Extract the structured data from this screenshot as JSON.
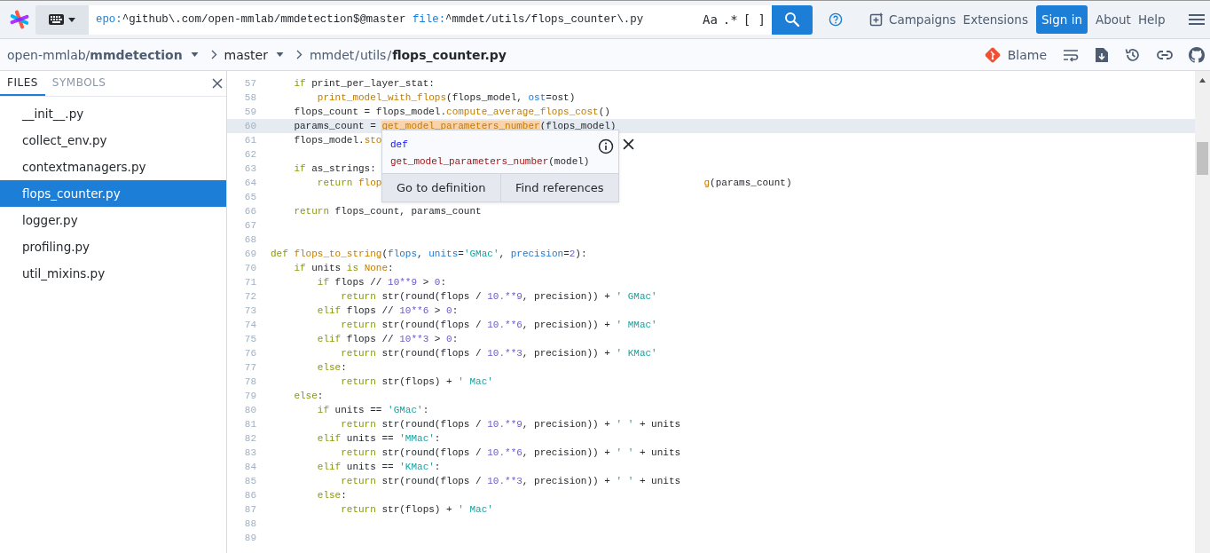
{
  "search": {
    "query": [
      {
        "kind": "filter",
        "text": "epo:"
      },
      {
        "kind": "value",
        "text": "^github\\.com/open-mmlab/mmdetection$@master "
      },
      {
        "kind": "filter",
        "text": "file:"
      },
      {
        "kind": "value",
        "text": "^mmdet/utils/flops_counter\\.py"
      }
    ],
    "toggles": [
      {
        "label": "Aa",
        "on": false
      },
      {
        "label": ".*",
        "on": false
      },
      {
        "label": "[ ]",
        "on": false
      }
    ]
  },
  "nav": [
    {
      "kind": "link",
      "label": "Campaigns",
      "icon": true
    },
    {
      "kind": "link",
      "label": "Extensions",
      "icon": false
    },
    {
      "kind": "primary",
      "label": "Sign in",
      "icon": false
    },
    {
      "kind": "link",
      "label": "About",
      "icon": false
    },
    {
      "kind": "link",
      "label": "Help",
      "icon": false
    }
  ],
  "breadcrumb": {
    "repo": "open-mmlab/**mmdetection**",
    "revision": "master",
    "path": [
      {
        "kind": "segment",
        "text": "mmdet"
      },
      {
        "kind": "separator",
        "text": "/"
      },
      {
        "kind": "segment",
        "text": "utils"
      },
      {
        "kind": "separator",
        "text": "/"
      }
    ],
    "file": "flops_counter.py"
  },
  "actions": {
    "blame": "Blame"
  },
  "sidebar": {
    "tabs": [
      {
        "label": "FILES",
        "selected": true
      },
      {
        "label": "SYMBOLS",
        "selected": false
      }
    ],
    "items": [
      {
        "label": "__init__.py",
        "selected": false
      },
      {
        "label": "collect_env.py",
        "selected": false
      },
      {
        "label": "contextmanagers.py",
        "selected": false
      },
      {
        "label": "flops_counter.py",
        "selected": true
      },
      {
        "label": "logger.py",
        "selected": false
      },
      {
        "label": "profiling.py",
        "selected": false
      },
      {
        "label": "util_mixins.py",
        "selected": false
      }
    ]
  },
  "code": [
    {
      "n": "57",
      "highlighted": false,
      "tokens": [
        {
          "kind": "kw",
          "t": "    if"
        },
        {
          "kind": "p",
          "t": " print_per_layer_stat:"
        }
      ]
    },
    {
      "n": "58",
      "highlighted": false,
      "tokens": [
        {
          "kind": "fn",
          "t": "        print_model_with_flops"
        },
        {
          "kind": "p",
          "t": "(flops_model, "
        },
        {
          "kind": "param",
          "t": "ost"
        },
        {
          "kind": "p",
          "t": "=ost)"
        }
      ]
    },
    {
      "n": "59",
      "highlighted": false,
      "tokens": [
        {
          "kind": "p",
          "t": "    flops_count = flops_model."
        },
        {
          "kind": "fn",
          "t": "compute_average_flops_cost"
        },
        {
          "kind": "p",
          "t": "()"
        }
      ]
    },
    {
      "n": "60",
      "highlighted": true,
      "tokens": [
        {
          "kind": "p",
          "t": "    params_count = "
        },
        {
          "kind": "match",
          "t": "get_model_parameters_number"
        },
        {
          "kind": "p",
          "t": "(flops_model)"
        }
      ]
    },
    {
      "n": "61",
      "highlighted": false,
      "tokens": [
        {
          "kind": "p",
          "t": "    flops_model."
        },
        {
          "kind": "fn",
          "t": "sto"
        }
      ]
    },
    {
      "n": "62",
      "highlighted": false
    },
    {
      "n": "63",
      "highlighted": false,
      "tokens": [
        {
          "kind": "kw",
          "t": "    if"
        },
        {
          "kind": "p",
          "t": " as_strings:"
        }
      ]
    },
    {
      "n": "64",
      "highlighted": false,
      "tokens": [
        {
          "kind": "kw",
          "t": "        return"
        },
        {
          "kind": "fn",
          "t": " flop"
        }
      ],
      "tail": [
        {
          "kind": "fn",
          "t": "g"
        },
        {
          "kind": "p",
          "t": "(params_count)"
        }
      ]
    },
    {
      "n": "65",
      "highlighted": false
    },
    {
      "n": "66",
      "highlighted": false,
      "tokens": [
        {
          "kind": "kw",
          "t": "    return"
        },
        {
          "kind": "p",
          "t": " flops_count, params_count"
        }
      ]
    },
    {
      "n": "67",
      "highlighted": false
    },
    {
      "n": "68",
      "highlighted": false
    },
    {
      "n": "69",
      "highlighted": false,
      "tokens": [
        {
          "kind": "kw",
          "t": "def"
        },
        {
          "kind": "fn",
          "t": " flops_to_string"
        },
        {
          "kind": "p",
          "t": "("
        },
        {
          "kind": "param",
          "t": "flops"
        },
        {
          "kind": "p",
          "t": ", "
        },
        {
          "kind": "param",
          "t": "units"
        },
        {
          "kind": "p",
          "t": "="
        },
        {
          "kind": "str",
          "t": "'GMac'"
        },
        {
          "kind": "p",
          "t": ", "
        },
        {
          "kind": "param",
          "t": "precision"
        },
        {
          "kind": "p",
          "t": "="
        },
        {
          "kind": "num",
          "t": "2"
        },
        {
          "kind": "p",
          "t": "):"
        }
      ]
    },
    {
      "n": "70",
      "highlighted": false,
      "tokens": [
        {
          "kind": "kw",
          "t": "    if"
        },
        {
          "kind": "p",
          "t": " units "
        },
        {
          "kind": "kw",
          "t": "is"
        },
        {
          "kind": "fn",
          "t": " None"
        },
        {
          "kind": "p",
          "t": ":"
        }
      ]
    },
    {
      "n": "71",
      "highlighted": false,
      "tokens": [
        {
          "kind": "kw",
          "t": "        if"
        },
        {
          "kind": "p",
          "t": " flops // "
        },
        {
          "kind": "num",
          "t": "10**9"
        },
        {
          "kind": "p",
          "t": " > "
        },
        {
          "kind": "num",
          "t": "0"
        },
        {
          "kind": "p",
          "t": ":"
        }
      ]
    },
    {
      "n": "72",
      "highlighted": false,
      "tokens": [
        {
          "kind": "kw",
          "t": "            return"
        },
        {
          "kind": "p",
          "t": " str(round(flops / "
        },
        {
          "kind": "num",
          "t": "10.**9"
        },
        {
          "kind": "p",
          "t": ", precision)) + "
        },
        {
          "kind": "str",
          "t": "' GMac'"
        }
      ]
    },
    {
      "n": "73",
      "highlighted": false,
      "tokens": [
        {
          "kind": "kw",
          "t": "        elif"
        },
        {
          "kind": "p",
          "t": " flops // "
        },
        {
          "kind": "num",
          "t": "10**6"
        },
        {
          "kind": "p",
          "t": " > "
        },
        {
          "kind": "num",
          "t": "0"
        },
        {
          "kind": "p",
          "t": ":"
        }
      ]
    },
    {
      "n": "74",
      "highlighted": false,
      "tokens": [
        {
          "kind": "kw",
          "t": "            return"
        },
        {
          "kind": "p",
          "t": " str(round(flops / "
        },
        {
          "kind": "num",
          "t": "10.**6"
        },
        {
          "kind": "p",
          "t": ", precision)) + "
        },
        {
          "kind": "str",
          "t": "' MMac'"
        }
      ]
    },
    {
      "n": "75",
      "highlighted": false,
      "tokens": [
        {
          "kind": "kw",
          "t": "        elif"
        },
        {
          "kind": "p",
          "t": " flops // "
        },
        {
          "kind": "num",
          "t": "10**3"
        },
        {
          "kind": "p",
          "t": " > "
        },
        {
          "kind": "num",
          "t": "0"
        },
        {
          "kind": "p",
          "t": ":"
        }
      ]
    },
    {
      "n": "76",
      "highlighted": false,
      "tokens": [
        {
          "kind": "kw",
          "t": "            return"
        },
        {
          "kind": "p",
          "t": " str(round(flops / "
        },
        {
          "kind": "num",
          "t": "10.**3"
        },
        {
          "kind": "p",
          "t": ", precision)) + "
        },
        {
          "kind": "str",
          "t": "' KMac'"
        }
      ]
    },
    {
      "n": "77",
      "highlighted": false,
      "tokens": [
        {
          "kind": "kw",
          "t": "        else"
        },
        {
          "kind": "p",
          "t": ":"
        }
      ]
    },
    {
      "n": "78",
      "highlighted": false,
      "tokens": [
        {
          "kind": "kw",
          "t": "            return"
        },
        {
          "kind": "p",
          "t": " str(flops) + "
        },
        {
          "kind": "str",
          "t": "' Mac'"
        }
      ]
    },
    {
      "n": "79",
      "highlighted": false,
      "tokens": [
        {
          "kind": "kw",
          "t": "    else"
        },
        {
          "kind": "p",
          "t": ":"
        }
      ]
    },
    {
      "n": "80",
      "highlighted": false,
      "tokens": [
        {
          "kind": "kw",
          "t": "        if"
        },
        {
          "kind": "p",
          "t": " units == "
        },
        {
          "kind": "str",
          "t": "'GMac'"
        },
        {
          "kind": "p",
          "t": ":"
        }
      ]
    },
    {
      "n": "81",
      "highlighted": false,
      "tokens": [
        {
          "kind": "kw",
          "t": "            return"
        },
        {
          "kind": "p",
          "t": " str(round(flops / "
        },
        {
          "kind": "num",
          "t": "10.**9"
        },
        {
          "kind": "p",
          "t": ", precision)) + "
        },
        {
          "kind": "str",
          "t": "' '"
        },
        {
          "kind": "p",
          "t": " + units"
        }
      ]
    },
    {
      "n": "82",
      "highlighted": false,
      "tokens": [
        {
          "kind": "kw",
          "t": "        elif"
        },
        {
          "kind": "p",
          "t": " units == "
        },
        {
          "kind": "str",
          "t": "'MMac'"
        },
        {
          "kind": "p",
          "t": ":"
        }
      ]
    },
    {
      "n": "83",
      "highlighted": false,
      "tokens": [
        {
          "kind": "kw",
          "t": "            return"
        },
        {
          "kind": "p",
          "t": " str(round(flops / "
        },
        {
          "kind": "num",
          "t": "10.**6"
        },
        {
          "kind": "p",
          "t": ", precision)) + "
        },
        {
          "kind": "str",
          "t": "' '"
        },
        {
          "kind": "p",
          "t": " + units"
        }
      ]
    },
    {
      "n": "84",
      "highlighted": false,
      "tokens": [
        {
          "kind": "kw",
          "t": "        elif"
        },
        {
          "kind": "p",
          "t": " units == "
        },
        {
          "kind": "str",
          "t": "'KMac'"
        },
        {
          "kind": "p",
          "t": ":"
        }
      ]
    },
    {
      "n": "85",
      "highlighted": false,
      "tokens": [
        {
          "kind": "kw",
          "t": "            return"
        },
        {
          "kind": "p",
          "t": " str(round(flops / "
        },
        {
          "kind": "num",
          "t": "10.**3"
        },
        {
          "kind": "p",
          "t": ", precision)) + "
        },
        {
          "kind": "str",
          "t": "' '"
        },
        {
          "kind": "p",
          "t": " + units"
        }
      ]
    },
    {
      "n": "86",
      "highlighted": false,
      "tokens": [
        {
          "kind": "kw",
          "t": "        else"
        },
        {
          "kind": "p",
          "t": ":"
        }
      ]
    },
    {
      "n": "87",
      "highlighted": false,
      "tokens": [
        {
          "kind": "kw",
          "t": "            return"
        },
        {
          "kind": "p",
          "t": " str(flops) + "
        },
        {
          "kind": "str",
          "t": "' Mac'"
        }
      ]
    },
    {
      "n": "88",
      "highlighted": false
    },
    {
      "n": "89",
      "highlighted": false
    }
  ],
  "popup": {
    "keyword": "def",
    "signature": [
      {
        "kind": "fn",
        "t": "get_model_parameters_number"
      },
      {
        "kind": "p",
        "t": "(model)"
      }
    ],
    "buttons": [
      "Go to definition",
      "Find references"
    ]
  }
}
